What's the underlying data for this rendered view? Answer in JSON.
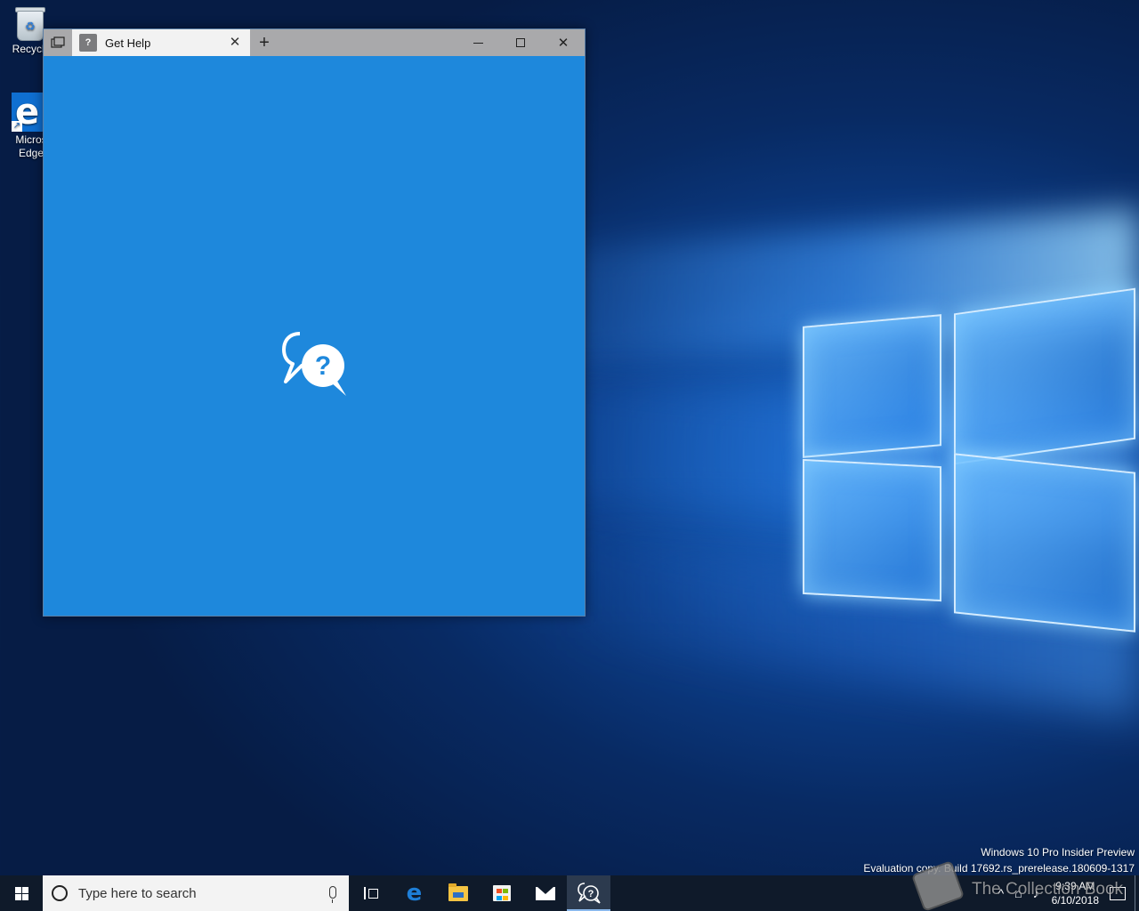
{
  "desktop": {
    "icons": [
      {
        "label": "Recycle"
      },
      {
        "label_line1": "Micros",
        "label_line2": "Edge"
      }
    ]
  },
  "window": {
    "tab_title": "Get Help",
    "tab_close_symbol": "✕",
    "new_tab_symbol": "+",
    "minimize_symbol": "",
    "close_symbol": "✕",
    "background_color": "#1e88dc"
  },
  "watermark": {
    "line1": "Windows 10 Pro Insider Preview",
    "line2": "Evaluation copy. Build 17692.rs_prerelease.180609-1317"
  },
  "taskbar": {
    "search_placeholder": "Type here to search",
    "pinned": [
      "task-view",
      "microsoft-edge",
      "file-explorer",
      "microsoft-store",
      "mail",
      "get-help"
    ],
    "active_app": "get-help",
    "clock_time": "9:39 AM",
    "clock_date": "6/10/2018"
  },
  "overlay_logo": {
    "text": "The Collection Book"
  },
  "icons": {
    "tray_chevron": "^",
    "tray_network": "⌂",
    "tray_volume": "♪"
  }
}
